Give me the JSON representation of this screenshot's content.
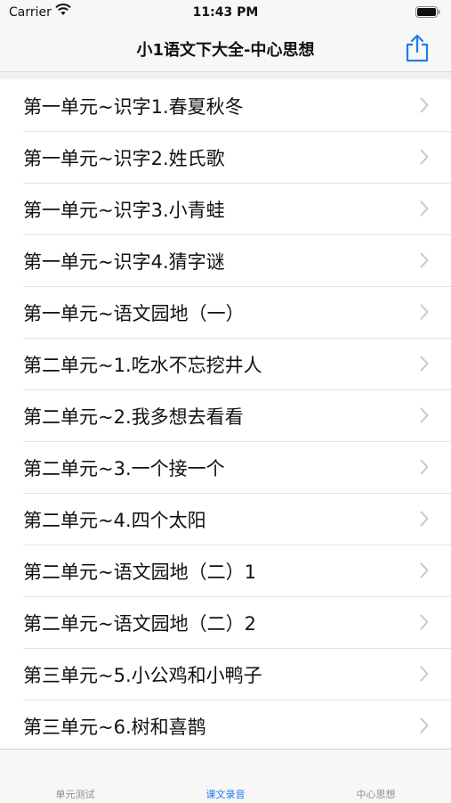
{
  "status_bar": {
    "carrier": "Carrier",
    "time": "11:43 PM"
  },
  "nav": {
    "title": "小1语文下大全-中心思想",
    "share_icon": "share-icon"
  },
  "list": {
    "items": [
      "第一单元~识字1.春夏秋冬",
      "第一单元~识字2.姓氏歌",
      "第一单元~识字3.小青蛙",
      "第一单元~识字4.猜字谜",
      "第一单元~语文园地（一）",
      "第二单元~1.吃水不忘挖井人",
      "第二单元~2.我多想去看看",
      "第二单元~3.一个接一个",
      "第二单元~4.四个太阳",
      "第二单元~语文园地（二）1",
      "第二单元~语文园地（二）2",
      "第三单元~5.小公鸡和小鸭子",
      "第三单元~6.树和喜鹊"
    ]
  },
  "tabs": [
    {
      "label": "单元测试",
      "active": false
    },
    {
      "label": "课文录音",
      "active": true
    },
    {
      "label": "中心思想",
      "active": false
    }
  ],
  "colors": {
    "accent": "#1e7cf2",
    "inactive": "#8e8e93",
    "chevron": "#c7c7cc"
  }
}
